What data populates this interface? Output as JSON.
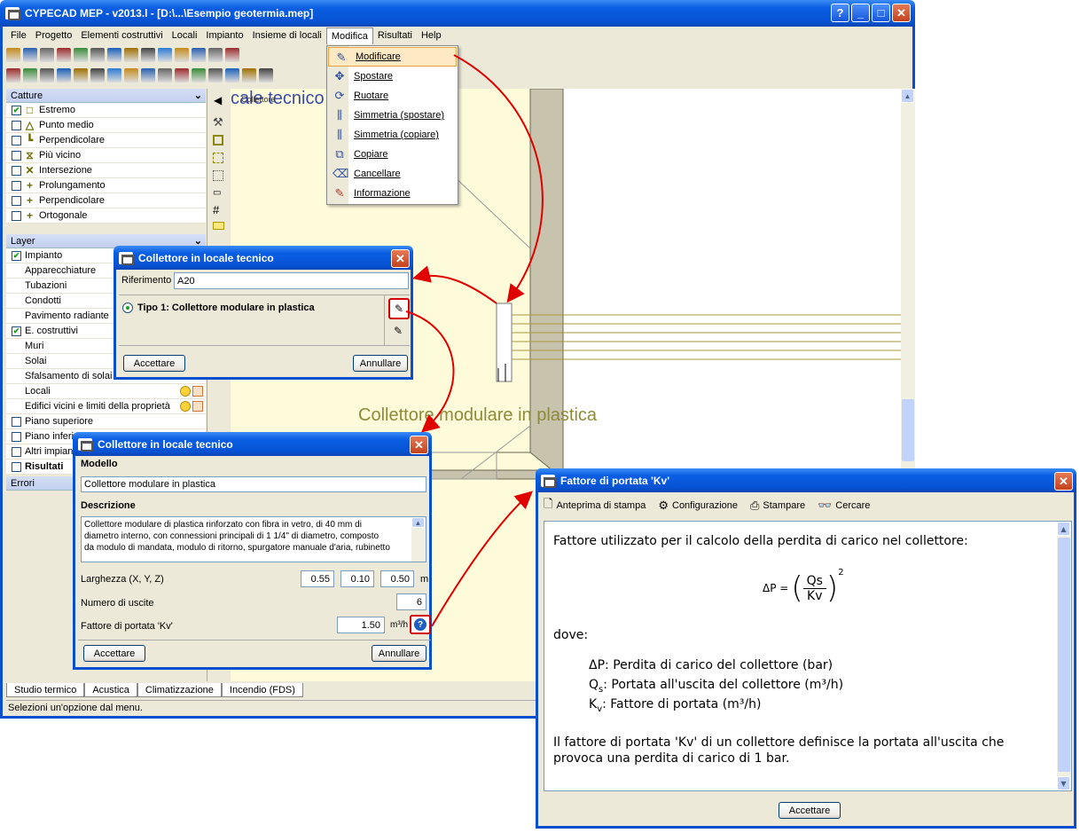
{
  "main_window": {
    "title": "CYPECAD MEP - v2013.l - [D:\\...\\Esempio geotermia.mep]",
    "menus": [
      "File",
      "Progetto",
      "Elementi costruttivi",
      "Locali",
      "Impianto",
      "Insieme di locali",
      "Modifica",
      "Risultati",
      "Help"
    ],
    "open_menu": "Modifica",
    "status": "Selezioni un'opzione dal menu.",
    "tabs": [
      "Studio termico",
      "Acustica",
      "Climatizzazione",
      "Incendio (FDS)"
    ]
  },
  "modifica_menu": {
    "items": [
      {
        "label": "Modificare",
        "icon": "pencil-icon"
      },
      {
        "label": "Spostare",
        "icon": "move-icon"
      },
      {
        "label": "Ruotare",
        "icon": "rotate-icon"
      },
      {
        "label": "Simmetria (spostare)",
        "icon": "mirror-move-icon"
      },
      {
        "label": "Simmetria (copiare)",
        "icon": "mirror-copy-icon"
      },
      {
        "label": "Copiare",
        "icon": "copy-icon"
      },
      {
        "label": "Cancellare",
        "icon": "eraser-icon"
      },
      {
        "label": "Informazione",
        "icon": "info-icon"
      }
    ]
  },
  "catture": {
    "title": "Catture",
    "items": [
      {
        "label": "Estremo",
        "checked": true,
        "icon": "square-snap-icon"
      },
      {
        "label": "Punto medio",
        "checked": false,
        "icon": "triangle-snap-icon"
      },
      {
        "label": "Perpendicolare",
        "checked": false,
        "icon": "perpendicular-snap-icon"
      },
      {
        "label": "Più vicino",
        "checked": false,
        "icon": "nearest-snap-icon"
      },
      {
        "label": "Intersezione",
        "checked": false,
        "icon": "intersection-snap-icon"
      },
      {
        "label": "Prolungamento",
        "checked": false,
        "icon": "plus-snap-icon"
      },
      {
        "label": "Perpendicolare",
        "checked": false,
        "icon": "plus-snap-icon"
      },
      {
        "label": "Ortogonale",
        "checked": false,
        "icon": "plus-snap-icon"
      }
    ]
  },
  "layer": {
    "title": "Layer",
    "items": [
      {
        "label": "Impianto",
        "checked": true,
        "indent": false
      },
      {
        "label": "Apparecchiature",
        "indent": true
      },
      {
        "label": "Tubazioni",
        "indent": true
      },
      {
        "label": "Condotti",
        "indent": true
      },
      {
        "label": "Pavimento radiante",
        "indent": true
      },
      {
        "label": "E. costruttivi",
        "checked": true,
        "indent": false
      },
      {
        "label": "Muri",
        "indent": true
      },
      {
        "label": "Solai",
        "indent": true
      },
      {
        "label": "Sfalsamento di solai",
        "indent": true
      },
      {
        "label": "Locali",
        "indent": true
      },
      {
        "label": "Edifici vicini e limiti della proprietà",
        "indent": true
      },
      {
        "label": "Piano superiore",
        "checked": false,
        "indent": false
      },
      {
        "label": "Piano inferiore",
        "checked": false,
        "indent": false
      },
      {
        "label": "Altri impianti",
        "checked": false,
        "indent": false
      },
      {
        "label": "Risultati",
        "checked": false,
        "indent": false,
        "bold": true
      }
    ]
  },
  "errori": {
    "title": "Errori"
  },
  "canvas": {
    "label_top": "cale tecnico",
    "label_top_small": "Collettore",
    "label_collector": "Collettore modulare in plastica"
  },
  "dialog1": {
    "title": "Collettore in locale tecnico",
    "riferimento_label": "Riferimento",
    "riferimento_value": "A20",
    "type_label": "Tipo 1: Collettore modulare in plastica",
    "ok": "Accettare",
    "cancel": "Annullare"
  },
  "dialog2": {
    "title": "Collettore in locale tecnico",
    "modello_label": "Modello",
    "modello_value": "Collettore modulare in plastica",
    "descrizione_label": "Descrizione",
    "descrizione_lines": [
      "Collettore modulare di plastica rinforzato con fibra in vetro, di 40 mm di",
      "diametro interno, con connessioni principali di 1 1/4\" di diametro, composto",
      "da modulo di mandata, modulo di ritorno, spurgatore manuale d'aria, rubinetto"
    ],
    "larghezza_label": "Larghezza (X, Y, Z)",
    "larghezza_values": [
      "0.55",
      "0.10",
      "0.50"
    ],
    "larghezza_unit": "m",
    "uscite_label": "Numero di uscite",
    "uscite_value": "6",
    "kv_label": "Fattore di portata 'Kv'",
    "kv_value": "1.50",
    "kv_unit": "m³/h",
    "ok": "Accettare",
    "cancel": "Annullare"
  },
  "help_dialog": {
    "title": "Fattore di portata 'Kv'",
    "toolbar": [
      "Anteprima di stampa",
      "Configurazione",
      "Stampare",
      "Cercare"
    ],
    "intro": "Fattore utilizzato per il calcolo della perdita di carico nel collettore:",
    "formula": {
      "lhs": "ΔP =",
      "num": "Qs",
      "den": "Kv",
      "exp": "2"
    },
    "dove": "dove:",
    "defs": [
      {
        "sym": "ΔP",
        "sub": "",
        "text": ": Perdita di carico del collettore (bar)"
      },
      {
        "sym": "Q",
        "sub": "s",
        "text": ": Portata all'uscita del collettore (m³/h)"
      },
      {
        "sym": "K",
        "sub": "v",
        "text": ": Fattore di portata (m³/h)"
      }
    ],
    "note_lines": [
      "Il fattore di portata 'Kv' di un collettore definisce la portata all'uscita che",
      "provoca una perdita di carico di 1 bar."
    ],
    "ok": "Accettare"
  }
}
